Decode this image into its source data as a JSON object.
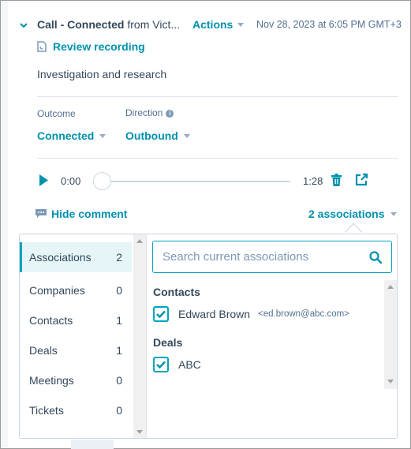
{
  "header": {
    "title_bold": "Call - Connected",
    "title_rest": " from Vict...",
    "actions_label": "Actions",
    "timestamp": "Nov 28, 2023 at 6:05 PM GMT+3"
  },
  "review_recording_label": "Review recording",
  "description": "Investigation and research",
  "fields": {
    "outcome": {
      "label": "Outcome",
      "value": "Connected"
    },
    "direction": {
      "label": "Direction",
      "value": "Outbound"
    }
  },
  "player": {
    "current_time": "0:00",
    "duration": "1:28",
    "progress_percent": 0
  },
  "hide_comment_label": "Hide comment",
  "associations_toggle_label": "2 associations",
  "associations_panel": {
    "nav": [
      {
        "label": "Associations",
        "count": "2",
        "active": true
      },
      {
        "label": "Companies",
        "count": "0"
      },
      {
        "label": "Contacts",
        "count": "1"
      },
      {
        "label": "Deals",
        "count": "1"
      },
      {
        "label": "Meetings",
        "count": "0"
      },
      {
        "label": "Tickets",
        "count": "0"
      }
    ],
    "search_placeholder": "Search current associations",
    "groups": [
      {
        "heading": "Contacts",
        "items": [
          {
            "name": "Edward Brown",
            "email": "<ed.brown@abc.com>",
            "checked": true
          }
        ]
      },
      {
        "heading": "Deals",
        "items": [
          {
            "name": "ABC",
            "checked": true
          }
        ]
      }
    ]
  },
  "colors": {
    "accent": "#0091ae",
    "text": "#33475b",
    "muted": "#516f90",
    "active_bg": "#e5f5f8"
  }
}
